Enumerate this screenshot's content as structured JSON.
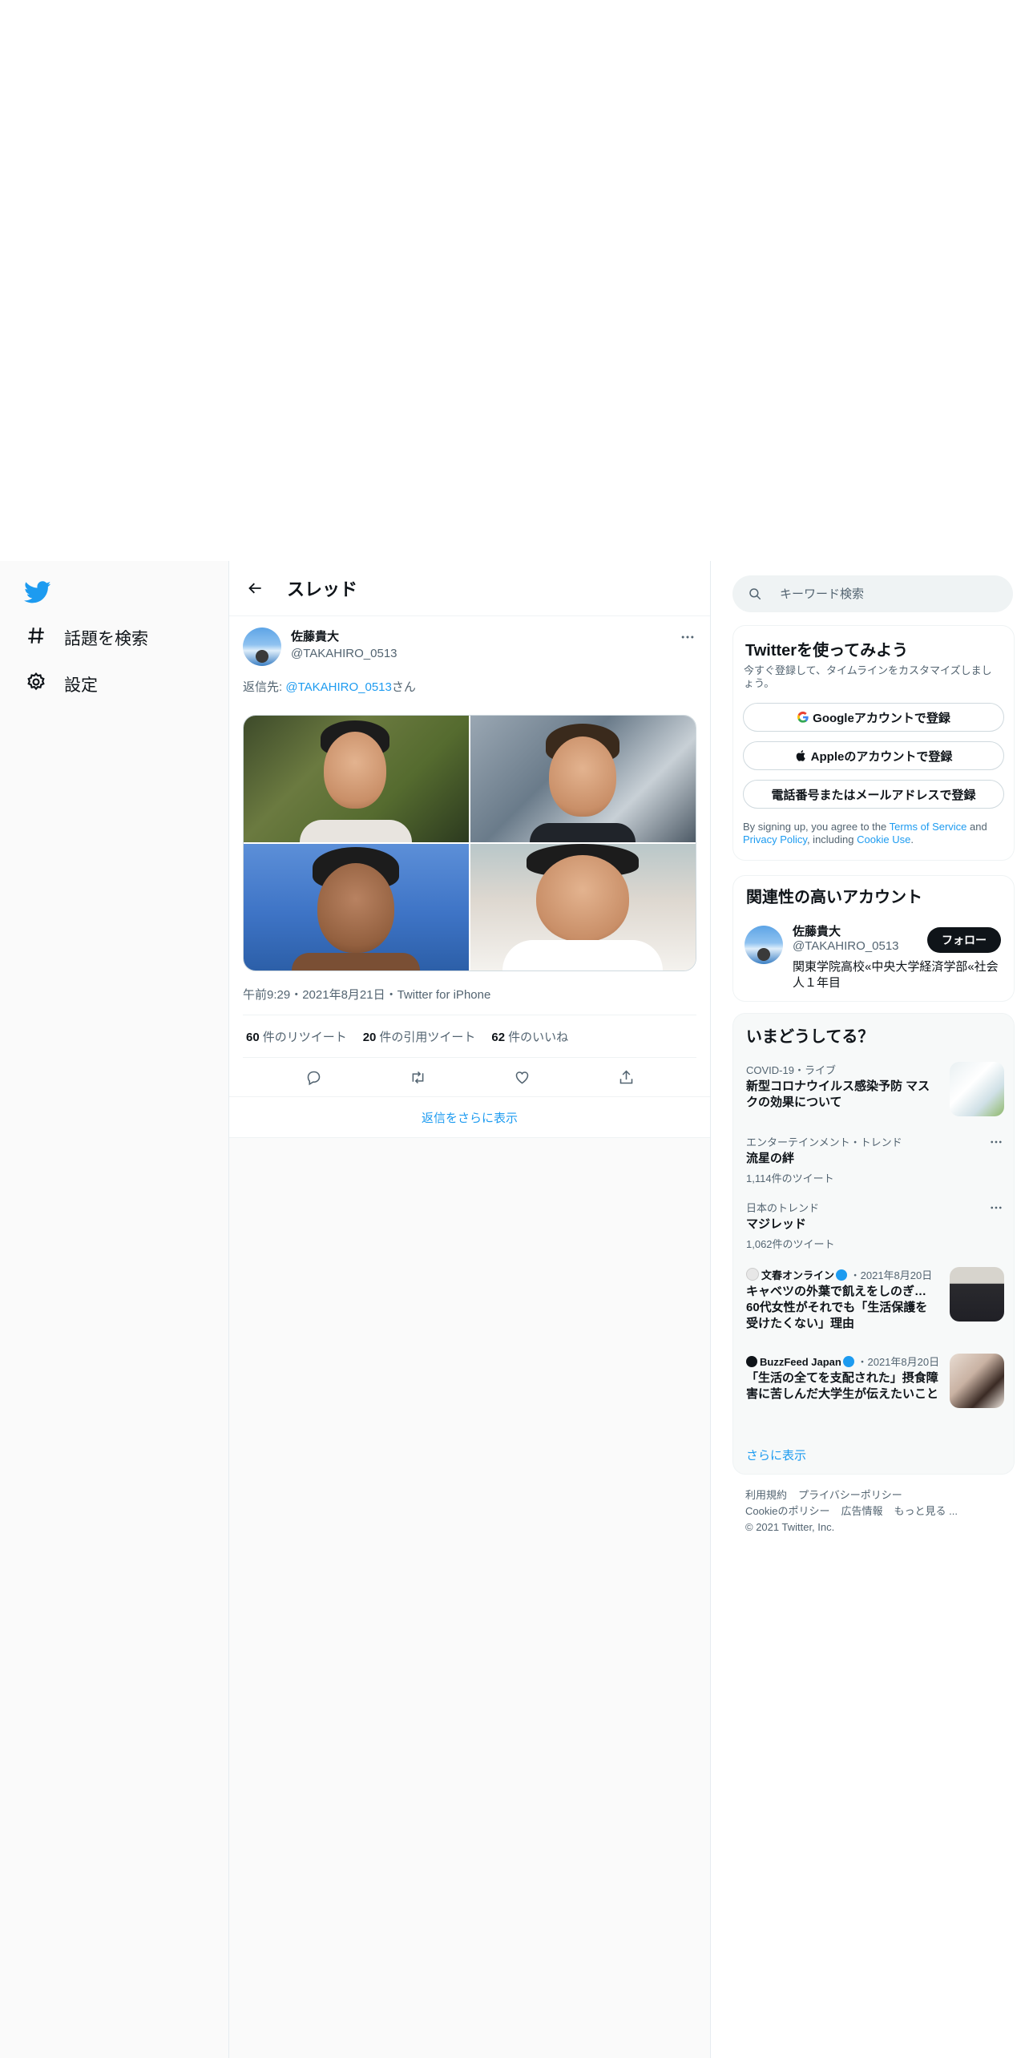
{
  "nav": {
    "logo": "twitter-bird",
    "items": [
      {
        "label": "話題を検索",
        "icon": "hashtag-icon"
      },
      {
        "label": "設定",
        "icon": "gear-icon"
      }
    ]
  },
  "header": {
    "title": "スレッド"
  },
  "tweet": {
    "author_name": "佐藤貴大",
    "author_handle": "@TAKAHIRO_0513",
    "reply_prefix": "返信先: ",
    "reply_handle": "@TAKAHIRO_0513",
    "reply_suffix": "さん",
    "timestamp": "午前9:29・2021年8月21日・Twitter for iPhone",
    "stats": {
      "retweets_count": "60",
      "retweets_label": "件のリツイート",
      "quotes_count": "20",
      "quotes_label": "件の引用ツイート",
      "likes_count": "62",
      "likes_label": "件のいいね"
    },
    "more_replies": "返信をさらに表示"
  },
  "search": {
    "placeholder": "キーワード検索"
  },
  "signup": {
    "title": "Twitterを使ってみよう",
    "subtitle": "今すぐ登録して、タイムラインをカスタマイズしましょう。",
    "google": "Googleアカウントで登録",
    "apple": "Appleのアカウントで登録",
    "phone_email": "電話番号またはメールアドレスで登録",
    "terms_pre": "By signing up, you agree to the ",
    "terms_tos": "Terms of Service",
    "terms_and": " and ",
    "terms_privacy": "Privacy Policy",
    "terms_incl": ", including ",
    "terms_cookie": "Cookie Use",
    "terms_end": "."
  },
  "related": {
    "title": "関連性の高いアカウント",
    "name": "佐藤貴大",
    "handle": "@TAKAHIRO_0513",
    "follow": "フォロー",
    "bio": "関東学院高校«中央大学経済学部«社会人１年目"
  },
  "trends": {
    "title": "いまどうしてる？",
    "items": [
      {
        "context": "COVID-19・ライブ",
        "title": "新型コロナウイルス感染予防 マスクの効果について"
      },
      {
        "context": "エンターテインメント・トレンド",
        "title": "流星の絆",
        "count": "1,114件のツイート"
      },
      {
        "context": "日本のトレンド",
        "title": "マジレッド",
        "count": "1,062件のツイート"
      },
      {
        "source": "文春オンライン",
        "date": "・2021年8月20日",
        "title": "キャベツの外葉で飢えをしのぎ…60代女性がそれでも「生活保護を受けたくない」理由"
      },
      {
        "source": "BuzzFeed Japan",
        "date": "・2021年8月20日",
        "title": "「生活の全てを支配された」摂食障害に苦しんだ大学生が伝えたいこと"
      }
    ],
    "show_more": "さらに表示"
  },
  "footer": {
    "links": [
      "利用規約",
      "プライバシーポリシー",
      "Cookieのポリシー",
      "広告情報",
      "もっと見る ..."
    ],
    "copyright": "© 2021 Twitter, Inc."
  },
  "colors": {
    "accent": "#1d9bf0",
    "text": "#0f1419",
    "muted": "#536471"
  }
}
